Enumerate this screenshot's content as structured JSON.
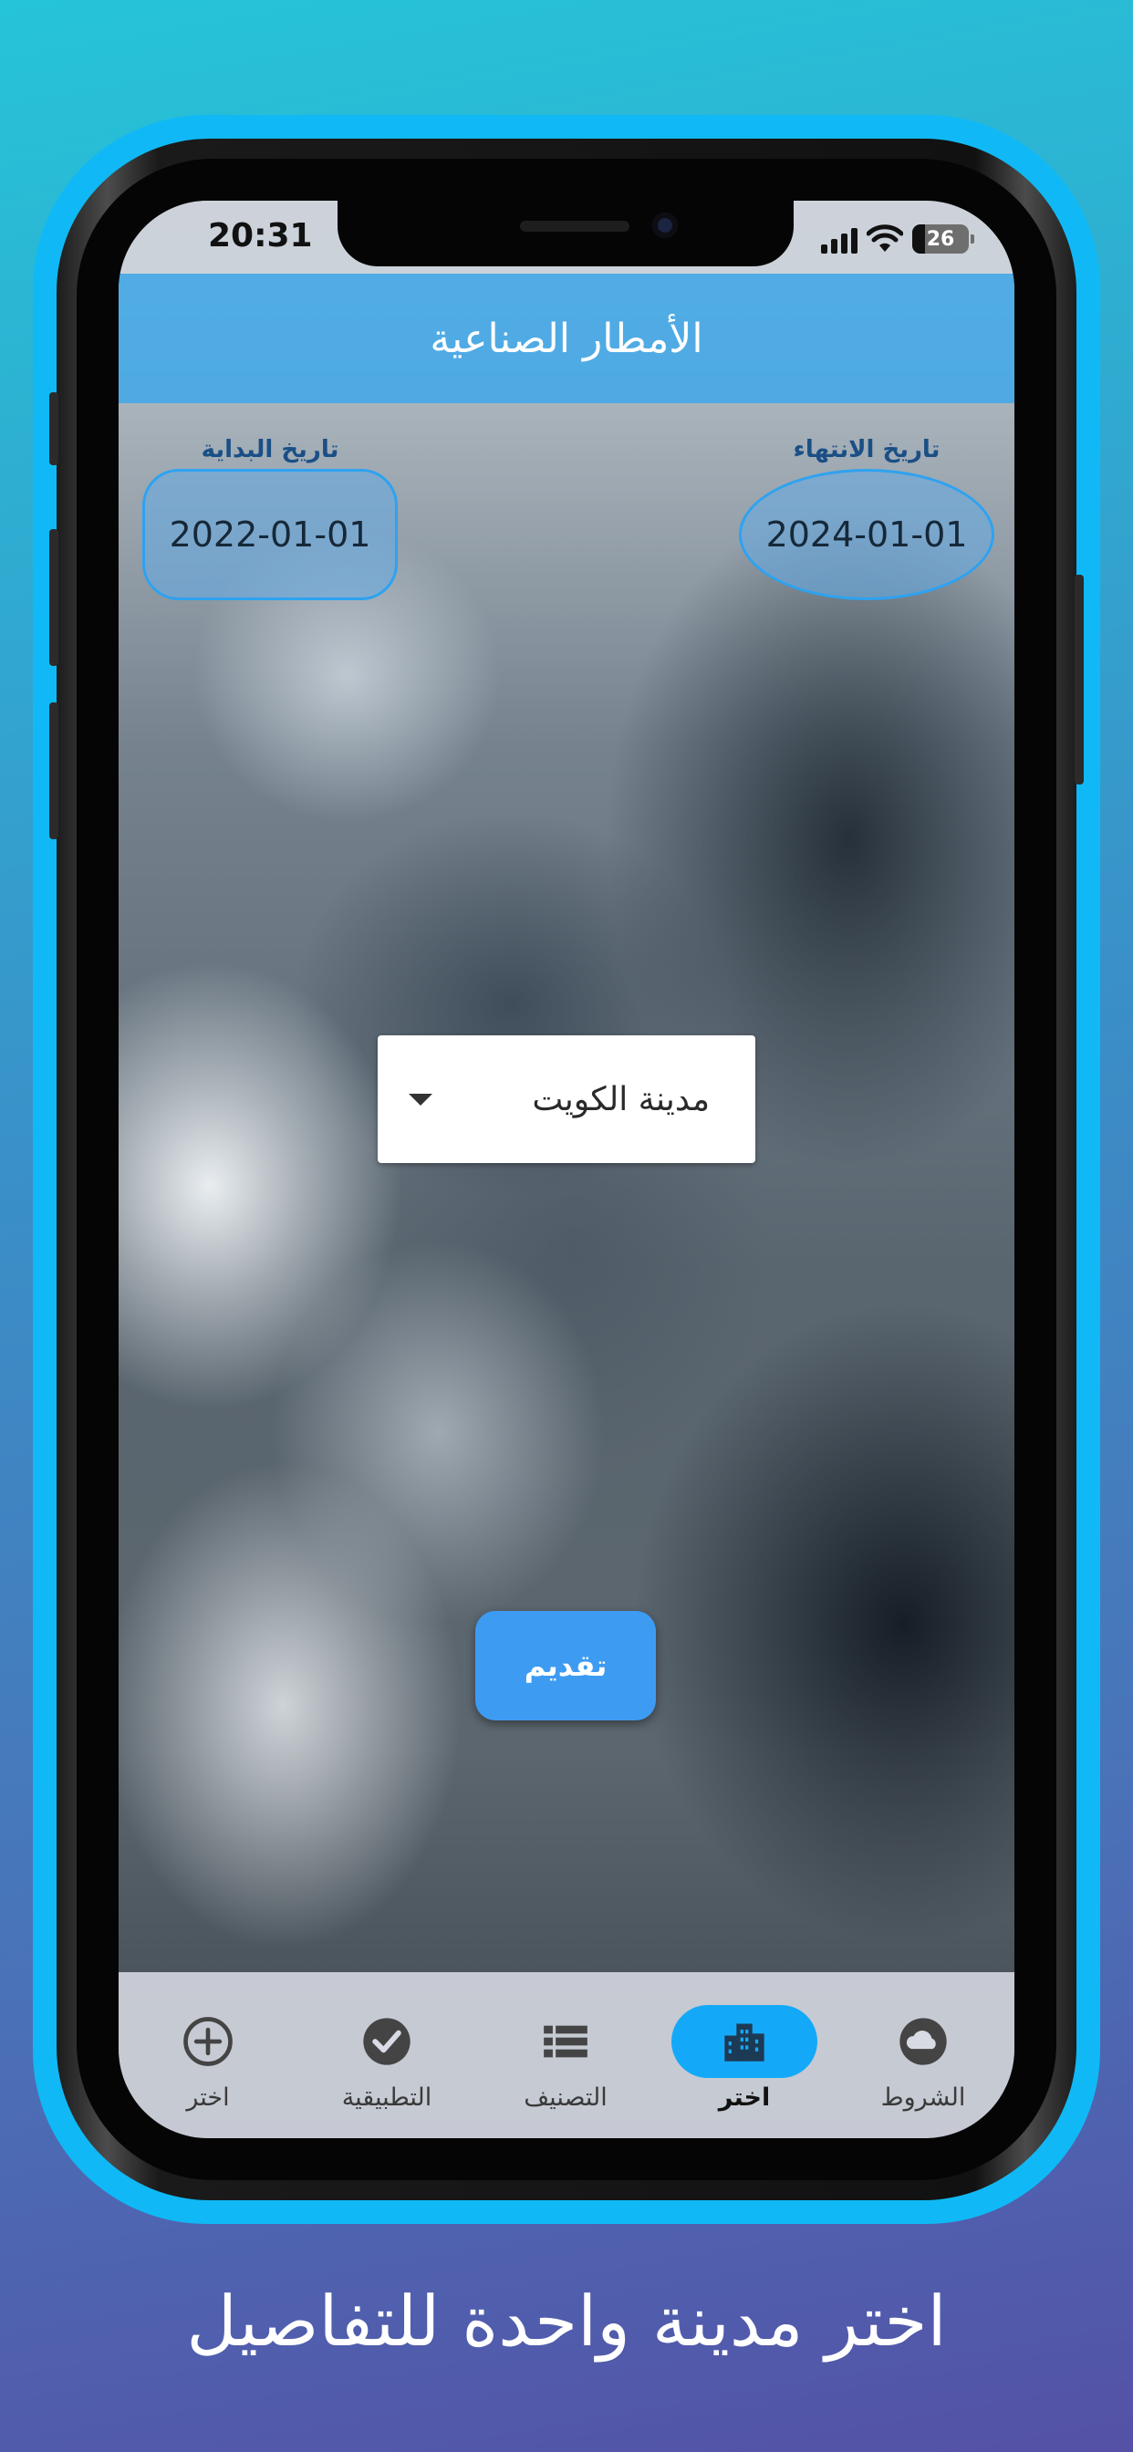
{
  "status": {
    "time": "20:31",
    "battery": "26"
  },
  "app": {
    "title": "الأمطار الصناعية"
  },
  "dates": {
    "start": {
      "label": "تاريخ البداية",
      "value": "2022-01-01"
    },
    "end": {
      "label": "تاريخ الانتهاء",
      "value": "2024-01-01"
    }
  },
  "city_select": {
    "selected": "مدينة الكويت"
  },
  "submit": {
    "label": "تقديم"
  },
  "nav": {
    "items": [
      {
        "label": "الشروط",
        "icon": "cloud-icon",
        "active": false
      },
      {
        "label": "اختر",
        "icon": "city-icon",
        "active": true
      },
      {
        "label": "التصنيف",
        "icon": "list-icon",
        "active": false
      },
      {
        "label": "التطبيقية",
        "icon": "check-circle-icon",
        "active": false
      },
      {
        "label": "اختر",
        "icon": "add-circle-icon",
        "active": false
      }
    ]
  },
  "caption": "اختر مدينة واحدة للتفاصيل",
  "colors": {
    "accent": "#14a9f8",
    "app_bar": "#42a8e8",
    "button": "#3d9bf2",
    "frame_glow": "#10b9f5"
  }
}
